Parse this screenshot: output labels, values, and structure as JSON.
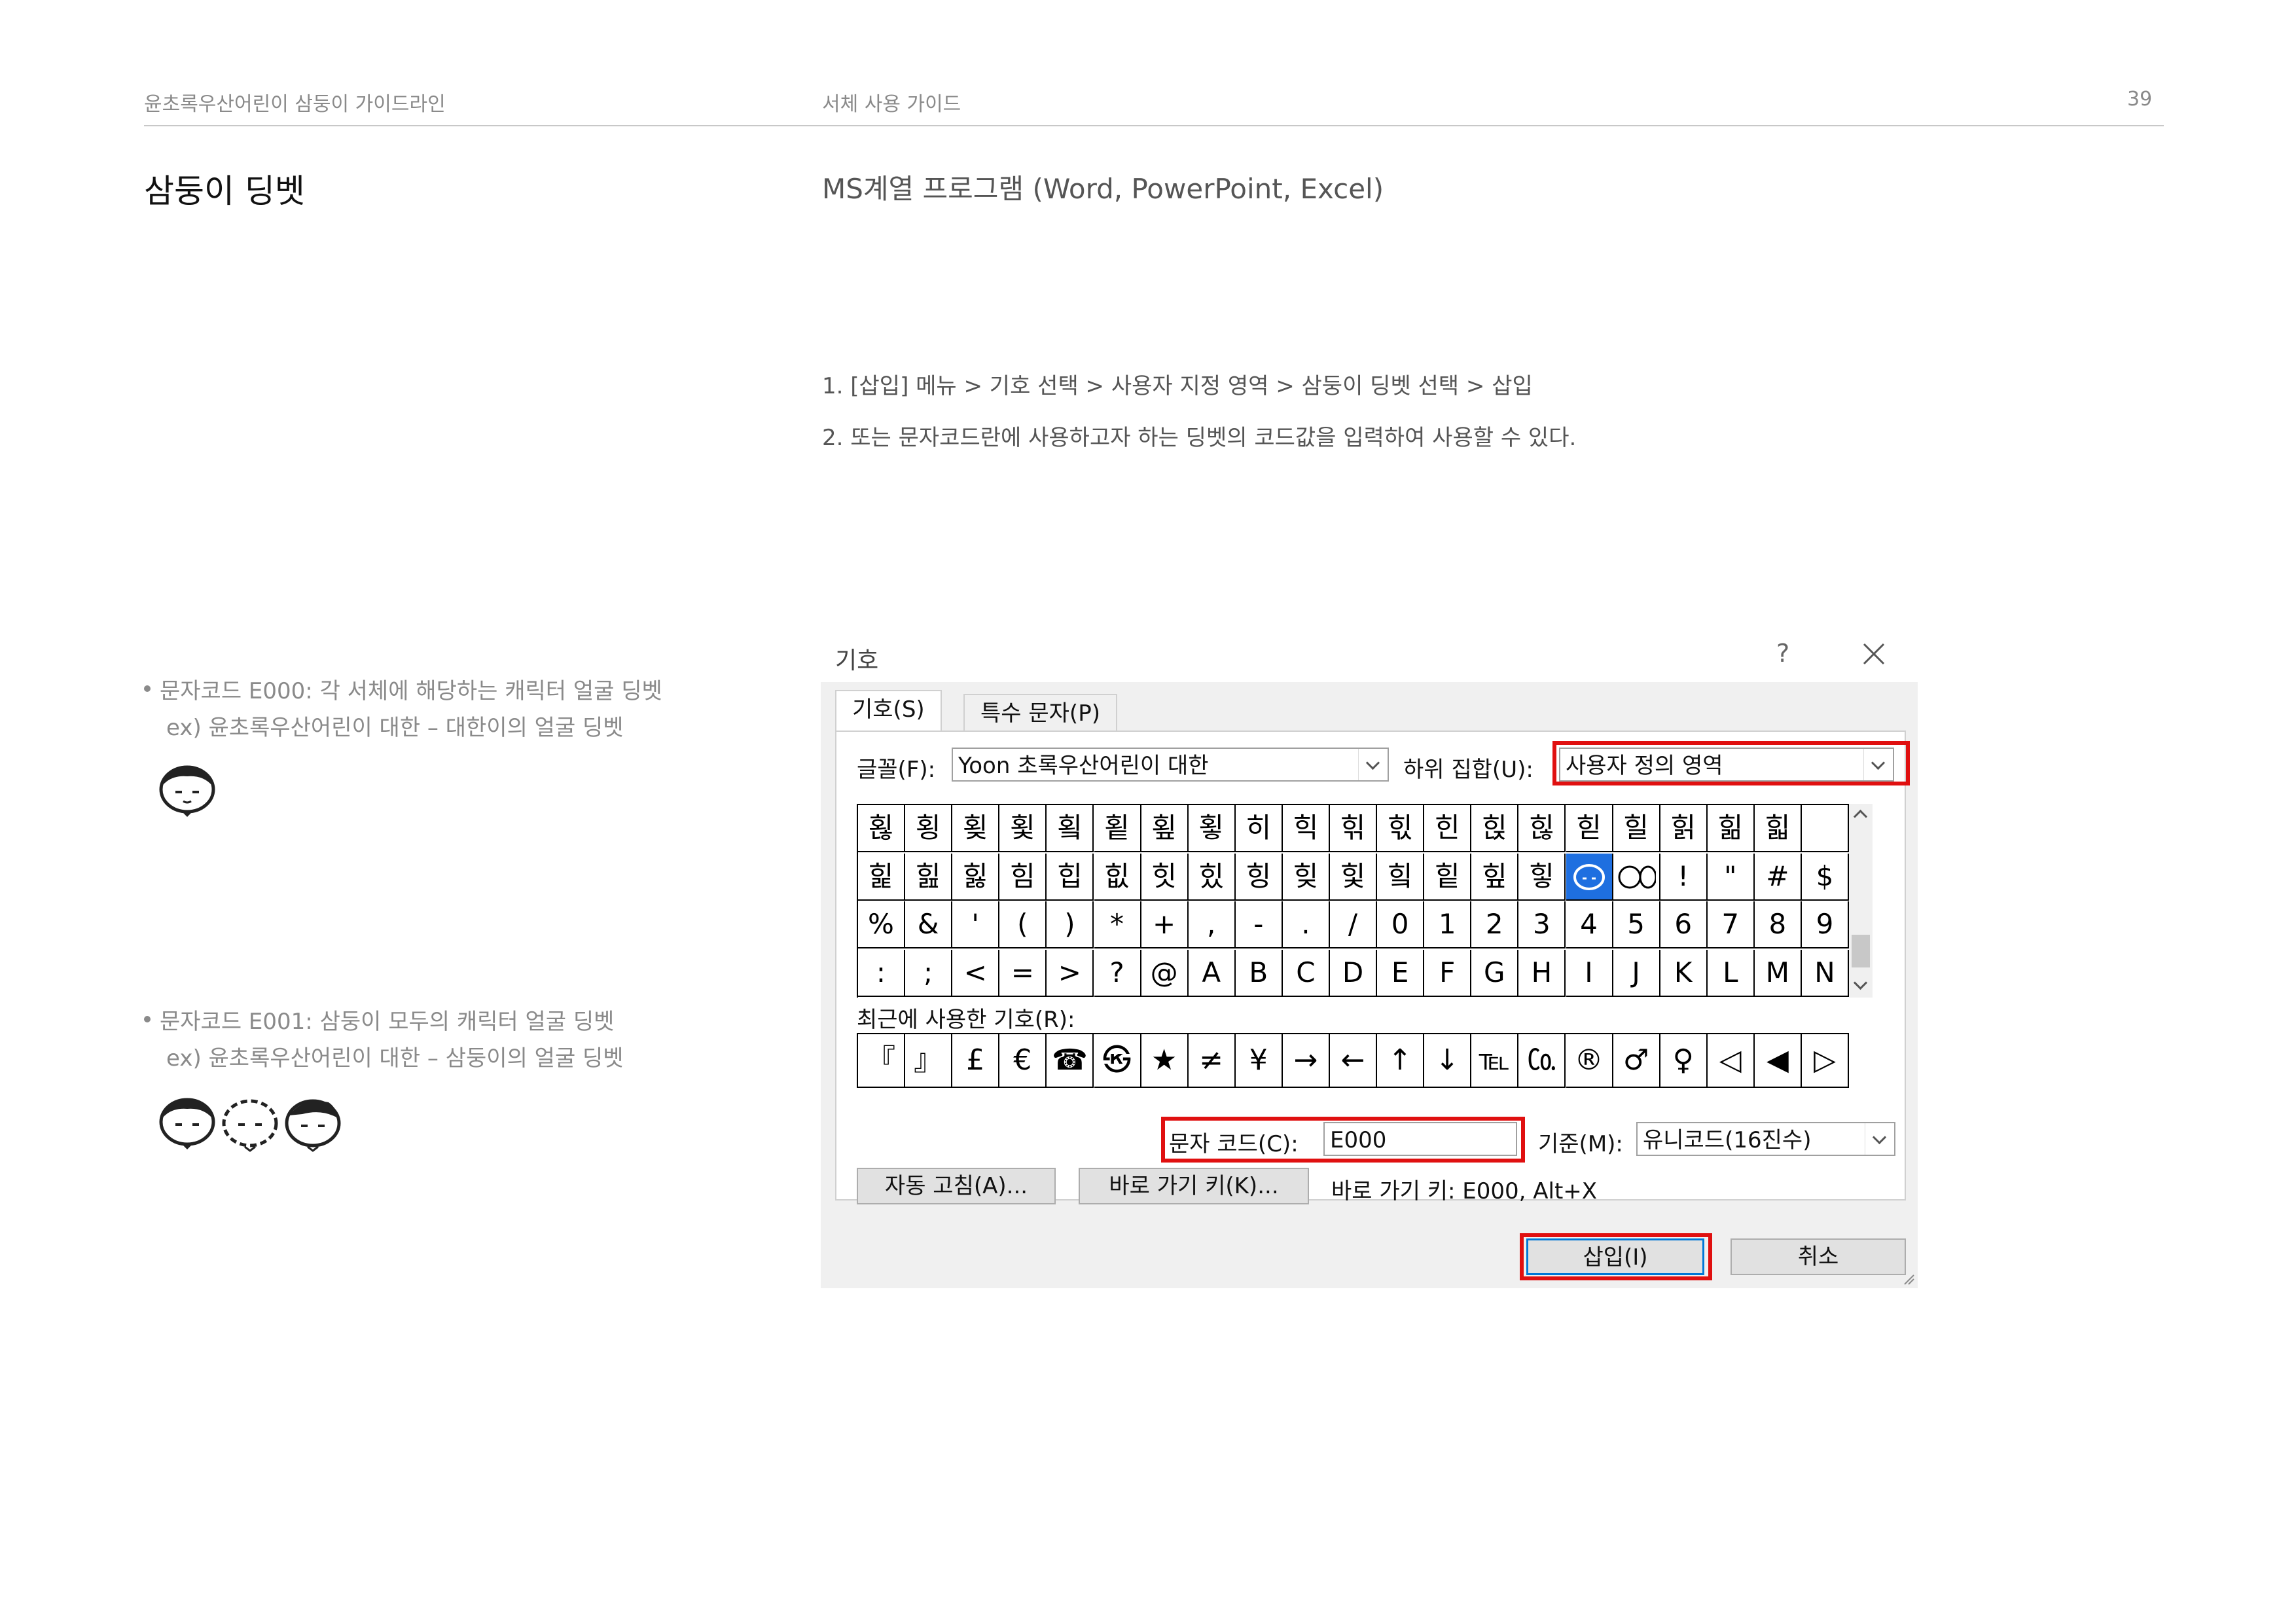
{
  "header": {
    "left": "윤초록우산어린이 삼둥이 가이드라인",
    "center": "서체 사용 가이드",
    "page_number": "39"
  },
  "section_title": "삼둥이 딩벳",
  "subtitle": "MS계열 프로그램 (Word, PowerPoint, Excel)",
  "steps": [
    "1. [삽입] 메뉴 > 기호 선택 > 사용자 지정 영역 > 삼둥이 딩벳 선택 > 삽입",
    "2. 또는 문자코드란에 사용하고자 하는 딩벳의 코드값을 입력하여 사용할 수 있다."
  ],
  "notes": [
    {
      "bullet": "문자코드 E000: 각 서체에 해당하는 캐릭터 얼굴 딩벳",
      "example": "ex) 윤초록우산어린이 대한 – 대한이의 얼굴 딩벳"
    },
    {
      "bullet": "문자코드 E001: 삼둥이 모두의 캐릭터 얼굴 딩벳",
      "example": "ex) 윤초록우산어린이 대한 – 삼둥이의 얼굴 딩벳"
    }
  ],
  "dialog": {
    "title": "기호",
    "help": "?",
    "tabs": [
      "기호(S)",
      "특수 문자(P)"
    ],
    "font_label": "글꼴(F):",
    "font_value": "Yoon 초록우산어린이 대한",
    "subset_label": "하위 집합(U):",
    "subset_value": "사용자 정의 영역",
    "grid_rows": [
      [
        "횒",
        "횡",
        "횢",
        "횣",
        "횤",
        "횥",
        "횦",
        "횧",
        "히",
        "힉",
        "힊",
        "힋",
        "힌",
        "힍",
        "힎",
        "힏",
        "힐",
        "힑",
        "힒",
        "힓"
      ],
      [
        "힕",
        "힖",
        "힗",
        "힘",
        "힙",
        "힚",
        "힛",
        "힜",
        "힝",
        "힞",
        "힟",
        "힠",
        "힡",
        "힢",
        "힣",
        "",
        "",
        "!",
        "\"",
        "#",
        "$"
      ],
      [
        "%",
        "&",
        "'",
        "(",
        ")",
        "*",
        "+",
        ",",
        "-",
        ".",
        "/",
        "0",
        "1",
        "2",
        "3",
        "4",
        "5",
        "6",
        "7",
        "8",
        "9"
      ],
      [
        ":",
        ";",
        "<",
        "=",
        ">",
        "?",
        "@",
        "A",
        "B",
        "C",
        "D",
        "E",
        "F",
        "G",
        "H",
        "I",
        "J",
        "K",
        "L",
        "M",
        "N"
      ]
    ],
    "recent_label": "최근에 사용한 기호(R):",
    "recent_symbols": [
      "『",
      "』",
      "£",
      "€",
      "☎",
      "㉿",
      "★",
      "≠",
      "¥",
      "→",
      "←",
      "↑",
      "↓",
      "℡",
      "㏇",
      "®",
      "♂",
      "♀",
      "◁",
      "◀",
      "▷"
    ],
    "char_code_label": "문자 코드(C):",
    "char_code_value": "E000",
    "basis_label": "기준(M):",
    "basis_value": "유니코드(16진수)",
    "autocorrect_button": "자동 고침(A)...",
    "shortcut_button": "바로 가기 키(K)...",
    "shortcut_text": "바로 가기 키: E000, Alt+X",
    "insert_button": "삽입(I)",
    "cancel_button": "취소"
  }
}
